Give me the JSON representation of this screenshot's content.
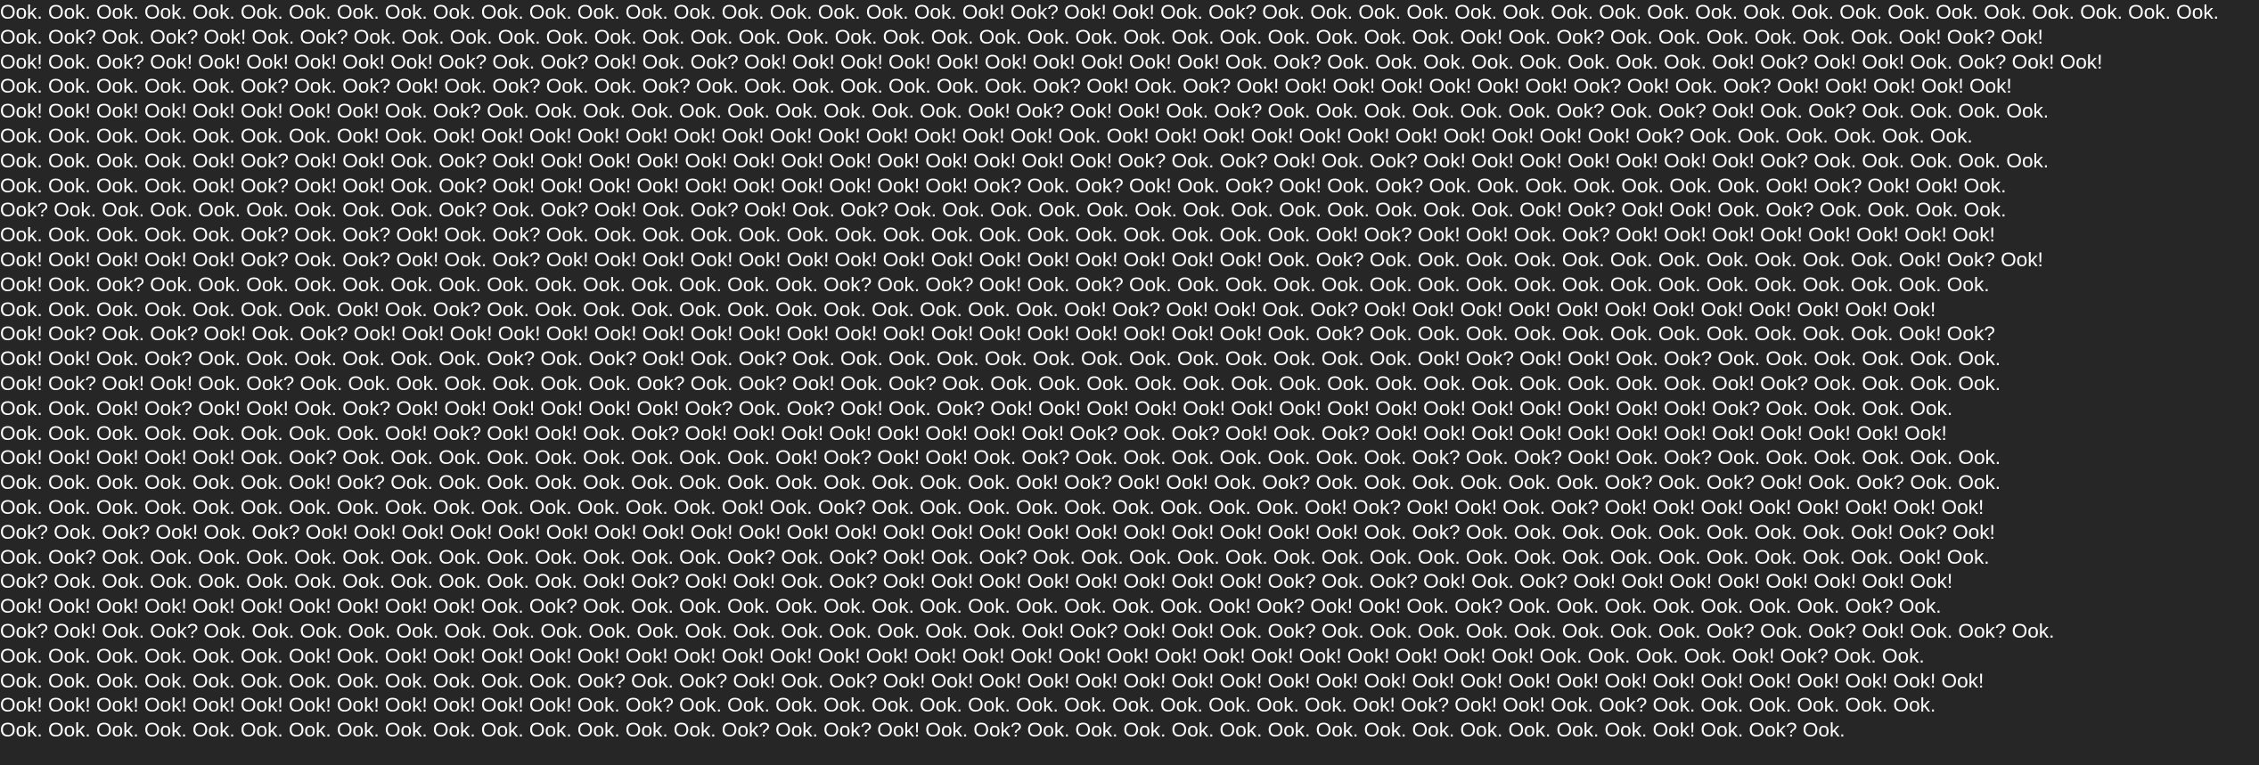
{
  "document": {
    "text": "Ook. Ook. Ook. Ook. Ook. Ook. Ook. Ook. Ook. Ook. Ook. Ook. Ook. Ook. Ook. Ook. Ook. Ook. Ook. Ook. Ook! Ook? Ook! Ook! Ook. Ook? Ook. Ook. Ook. Ook. Ook. Ook. Ook. Ook. Ook. Ook. Ook. Ook. Ook. Ook. Ook. Ook. Ook. Ook. Ook. Ook.\nOok. Ook? Ook. Ook? Ook! Ook. Ook? Ook. Ook. Ook. Ook. Ook. Ook. Ook. Ook. Ook. Ook. Ook. Ook. Ook. Ook. Ook. Ook. Ook. Ook. Ook. Ook. Ook. Ook. Ook. Ook! Ook. Ook? Ook. Ook. Ook. Ook. Ook. Ook. Ook! Ook? Ook!\nOok! Ook. Ook? Ook! Ook! Ook! Ook! Ook! Ook! Ook? Ook. Ook? Ook! Ook. Ook? Ook! Ook! Ook! Ook! Ook! Ook! Ook! Ook! Ook! Ook! Ook. Ook? Ook. Ook. Ook. Ook. Ook. Ook. Ook. Ook. Ook! Ook? Ook! Ook! Ook. Ook? Ook! Ook!\nOok. Ook. Ook. Ook. Ook. Ook? Ook. Ook? Ook! Ook. Ook? Ook. Ook. Ook? Ook. Ook. Ook. Ook. Ook. Ook. Ook. Ook? Ook! Ook. Ook? Ook! Ook! Ook! Ook! Ook! Ook! Ook! Ook? Ook! Ook. Ook? Ook! Ook! Ook! Ook! Ook!\nOok! Ook! Ook! Ook! Ook! Ook! Ook! Ook! Ook. Ook? Ook. Ook. Ook. Ook. Ook. Ook. Ook. Ook. Ook. Ook. Ook! Ook? Ook! Ook! Ook. Ook? Ook. Ook. Ook. Ook. Ook. Ook. Ook? Ook. Ook? Ook! Ook. Ook? Ook. Ook. Ook. Ook.\nOok. Ook. Ook. Ook. Ook. Ook. Ook. Ook! Ook. Ook! Ook! Ook! Ook! Ook! Ook! Ook! Ook! Ook! Ook! Ook! Ook! Ook! Ook. Ook! Ook! Ook! Ook! Ook! Ook! Ook! Ook! Ook! Ook! Ook! Ook? Ook. Ook. Ook. Ook. Ook. Ook.\nOok. Ook. Ook. Ook. Ook! Ook? Ook! Ook! Ook. Ook? Ook! Ook! Ook! Ook! Ook! Ook! Ook! Ook! Ook! Ook! Ook! Ook! Ook! Ook? Ook. Ook? Ook! Ook. Ook? Ook! Ook! Ook! Ook! Ook! Ook! Ook! Ook? Ook. Ook. Ook. Ook. Ook.\nOok. Ook. Ook. Ook. Ook! Ook? Ook! Ook! Ook. Ook? Ook! Ook! Ook! Ook! Ook! Ook! Ook! Ook! Ook! Ook! Ook? Ook. Ook? Ook! Ook. Ook? Ook! Ook. Ook? Ook. Ook. Ook. Ook. Ook. Ook. Ook. Ook! Ook? Ook! Ook! Ook.\nOok? Ook. Ook. Ook. Ook. Ook. Ook. Ook. Ook. Ook? Ook. Ook? Ook! Ook. Ook? Ook! Ook. Ook? Ook. Ook. Ook. Ook. Ook. Ook. Ook. Ook. Ook. Ook. Ook. Ook. Ook. Ook! Ook? Ook! Ook! Ook. Ook? Ook. Ook. Ook. Ook.\nOok. Ook. Ook. Ook. Ook. Ook? Ook. Ook? Ook! Ook. Ook? Ook. Ook. Ook. Ook. Ook. Ook. Ook. Ook. Ook. Ook. Ook. Ook. Ook. Ook. Ook. Ook. Ook! Ook? Ook! Ook! Ook. Ook? Ook! Ook! Ook! Ook! Ook! Ook! Ook! Ook!\nOok! Ook! Ook! Ook! Ook! Ook? Ook. Ook? Ook! Ook. Ook? Ook! Ook! Ook! Ook! Ook! Ook! Ook! Ook! Ook! Ook! Ook! Ook! Ook! Ook! Ook! Ook. Ook? Ook. Ook. Ook. Ook. Ook. Ook. Ook. Ook. Ook. Ook. Ook. Ook! Ook? Ook!\nOok! Ook. Ook? Ook. Ook. Ook. Ook. Ook. Ook. Ook. Ook. Ook. Ook. Ook. Ook. Ook. Ook. Ook? Ook. Ook? Ook! Ook. Ook? Ook. Ook. Ook. Ook. Ook. Ook. Ook. Ook. Ook. Ook. Ook. Ook. Ook. Ook. Ook. Ook. Ook. Ook.\nOok. Ook. Ook. Ook. Ook. Ook. Ook. Ook! Ook. Ook? Ook. Ook. Ook. Ook. Ook. Ook. Ook. Ook. Ook. Ook. Ook. Ook. Ook! Ook? Ook! Ook! Ook. Ook? Ook! Ook! Ook! Ook! Ook! Ook! Ook! Ook! Ook! Ook! Ook! Ook!\nOok! Ook? Ook. Ook? Ook! Ook. Ook? Ook! Ook! Ook! Ook! Ook! Ook! Ook! Ook! Ook! Ook! Ook! Ook! Ook! Ook! Ook! Ook! Ook! Ook! Ook! Ook. Ook? Ook. Ook. Ook. Ook. Ook. Ook. Ook. Ook. Ook. Ook. Ook. Ook! Ook?\nOok! Ook! Ook. Ook? Ook. Ook. Ook. Ook. Ook. Ook. Ook? Ook. Ook? Ook! Ook. Ook? Ook. Ook. Ook. Ook. Ook. Ook. Ook. Ook. Ook. Ook. Ook. Ook. Ook. Ook! Ook? Ook! Ook! Ook. Ook? Ook. Ook. Ook. Ook. Ook. Ook.\nOok! Ook? Ook! Ook! Ook. Ook? Ook. Ook. Ook. Ook. Ook. Ook. Ook. Ook? Ook. Ook? Ook! Ook. Ook? Ook. Ook. Ook. Ook. Ook. Ook. Ook. Ook. Ook. Ook. Ook. Ook. Ook. Ook. Ook. Ook. Ook! Ook? Ook. Ook. Ook. Ook.\nOok. Ook. Ook! Ook? Ook! Ook! Ook. Ook? Ook! Ook! Ook! Ook! Ook! Ook! Ook? Ook. Ook? Ook! Ook. Ook? Ook! Ook! Ook! Ook! Ook! Ook! Ook! Ook! Ook! Ook! Ook! Ook! Ook! Ook! Ook! Ook? Ook. Ook. Ook. Ook.\nOok. Ook. Ook. Ook. Ook. Ook. Ook. Ook. Ook! Ook? Ook! Ook! Ook. Ook? Ook! Ook! Ook! Ook! Ook! Ook! Ook! Ook! Ook? Ook. Ook? Ook! Ook. Ook? Ook! Ook! Ook! Ook! Ook! Ook! Ook! Ook! Ook! Ook! Ook! Ook!\nOok! Ook! Ook! Ook! Ook! Ook. Ook? Ook. Ook. Ook. Ook. Ook. Ook. Ook. Ook. Ook. Ook! Ook? Ook! Ook! Ook. Ook? Ook. Ook. Ook. Ook. Ook. Ook. Ook. Ook? Ook. Ook? Ook! Ook. Ook? Ook. Ook. Ook. Ook. Ook. Ook.\nOok. Ook. Ook. Ook. Ook. Ook. Ook! Ook? Ook. Ook. Ook. Ook. Ook. Ook. Ook. Ook. Ook. Ook. Ook. Ook. Ook. Ook! Ook? Ook! Ook! Ook. Ook? Ook. Ook. Ook. Ook. Ook. Ook. Ook? Ook. Ook? Ook! Ook. Ook? Ook. Ook.\nOok. Ook. Ook. Ook. Ook. Ook. Ook. Ook. Ook. Ook. Ook. Ook. Ook. Ook. Ook. Ook! Ook. Ook? Ook. Ook. Ook. Ook. Ook. Ook. Ook. Ook. Ook. Ook! Ook? Ook! Ook! Ook. Ook? Ook! Ook! Ook! Ook! Ook! Ook! Ook! Ook!\nOok? Ook. Ook? Ook! Ook. Ook? Ook! Ook! Ook! Ook! Ook! Ook! Ook! Ook! Ook! Ook! Ook! Ook! Ook! Ook! Ook! Ook! Ook! Ook! Ook! Ook! Ook! Ook! Ook. Ook? Ook. Ook. Ook. Ook. Ook. Ook. Ook. Ook. Ook! Ook? Ook!\nOok. Ook? Ook. Ook. Ook. Ook. Ook. Ook. Ook. Ook. Ook. Ook. Ook. Ook. Ook. Ook? Ook. Ook? Ook! Ook. Ook? Ook. Ook. Ook. Ook. Ook. Ook. Ook. Ook. Ook. Ook. Ook. Ook. Ook. Ook. Ook. Ook. Ook. Ook. Ook! Ook.\nOok? Ook. Ook. Ook. Ook. Ook. Ook. Ook. Ook. Ook. Ook. Ook. Ook! Ook? Ook! Ook! Ook. Ook? Ook! Ook! Ook! Ook! Ook! Ook! Ook! Ook! Ook? Ook. Ook? Ook! Ook. Ook? Ook! Ook! Ook! Ook! Ook! Ook! Ook! Ook!\nOok! Ook! Ook! Ook! Ook! Ook! Ook! Ook! Ook! Ook! Ook. Ook? Ook. Ook. Ook. Ook. Ook. Ook. Ook. Ook. Ook. Ook. Ook. Ook. Ook. Ook! Ook? Ook! Ook! Ook. Ook? Ook. Ook. Ook. Ook. Ook. Ook. Ook. Ook? Ook.\nOok? Ook! Ook. Ook? Ook. Ook. Ook. Ook. Ook. Ook. Ook. Ook. Ook. Ook. Ook. Ook. Ook. Ook. Ook. Ook. Ook. Ook! Ook? Ook! Ook! Ook. Ook? Ook. Ook. Ook. Ook. Ook. Ook. Ook. Ook. Ook? Ook. Ook? Ook! Ook. Ook? Ook.\nOok. Ook. Ook. Ook. Ook. Ook. Ook! Ook. Ook! Ook! Ook! Ook! Ook! Ook! Ook! Ook! Ook! Ook! Ook! Ook! Ook! Ook! Ook! Ook! Ook! Ook! Ook! Ook! Ook! Ook! Ook! Ook! Ook. Ook. Ook. Ook. Ook! Ook? Ook. Ook.\nOok. Ook. Ook. Ook. Ook. Ook. Ook. Ook. Ook. Ook. Ook. Ook. Ook? Ook. Ook? Ook! Ook. Ook? Ook! Ook! Ook! Ook! Ook! Ook! Ook! Ook! Ook! Ook! Ook! Ook! Ook! Ook! Ook! Ook! Ook! Ook! Ook! Ook! Ook! Ook! Ook!\nOok! Ook! Ook! Ook! Ook! Ook! Ook! Ook! Ook! Ook! Ook! Ook! Ook. Ook? Ook. Ook. Ook. Ook. Ook. Ook. Ook. Ook. Ook. Ook. Ook. Ook. Ook. Ook. Ook! Ook? Ook! Ook! Ook. Ook? Ook. Ook. Ook. Ook. Ook. Ook.\nOok. Ook. Ook. Ook. Ook. Ook. Ook. Ook. Ook. Ook. Ook. Ook. Ook. Ook. Ook. Ook? Ook. Ook? Ook! Ook. Ook? Ook. Ook. Ook. Ook. Ook. Ook. Ook. Ook. Ook. Ook. Ook. Ook. Ook. Ook! Ook. Ook? Ook."
  }
}
